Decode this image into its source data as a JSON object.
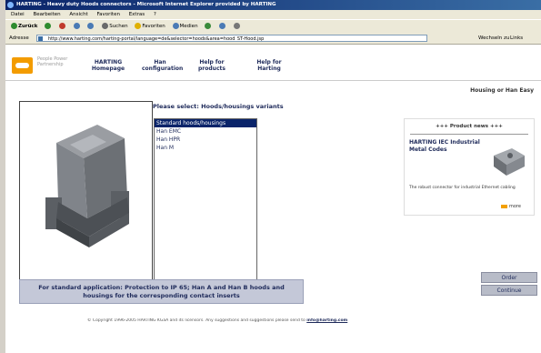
{
  "window": {
    "title": "HARTING - Heavy duty Hoods connectors - Microsoft Internet Explorer provided by HARTING"
  },
  "menu": [
    "Datei",
    "Bearbeiten",
    "Ansicht",
    "Favoriten",
    "Extras",
    "?"
  ],
  "toolbar": {
    "back": "Zurück",
    "search": "Suchen",
    "favorites": "Favoriten",
    "media": "Medien"
  },
  "address": {
    "label": "Adresse",
    "url": "http://www.harting.com/harting-portal/language=de&selector=hoods&area=hood_ST-Hood.jsp",
    "go": "Wechseln zu",
    "links": "Links"
  },
  "site": {
    "tagline": "People Power Partnership",
    "nav": [
      {
        "label": "HARTING Homepage"
      },
      {
        "label": "Han configuration"
      },
      {
        "label": "Help for products"
      },
      {
        "label": "Help for Harting"
      }
    ],
    "breadcrumb": "Housing or Han Easy"
  },
  "selector": {
    "title": "Please select: Hoods/housings variants",
    "options": [
      "Standard hoods/housings",
      "Han EMC",
      "Han HPR",
      "Han M"
    ],
    "selected_index": 0
  },
  "news": {
    "title": "+++ Product news +++",
    "headline": "HARTING IEC Industrial Metal Codes",
    "text": "The robust connector for industrial Ethernet cabling",
    "more": "more"
  },
  "description": "For standard application: Protection to IP 65; Han A and Han B hoods and housings for the corresponding contact inserts",
  "buttons": {
    "order": "Order",
    "continue": "Continue"
  },
  "footer": {
    "text": "© Copyright 1996-2005 HARTING KGaA and its licensors. Any suggestions and suggestions please send to",
    "link": "info@harting.com"
  }
}
